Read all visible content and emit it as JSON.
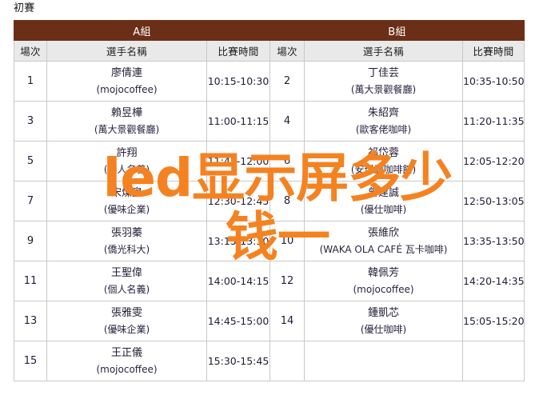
{
  "page": {
    "title": "初賽"
  },
  "watermark": {
    "line1": "led显示屏多少",
    "line2": "钱一",
    "color": "#F58220"
  },
  "table": {
    "colors": {
      "group_header_bg": "#6b2f18",
      "group_header_text": "#ffffff",
      "column_header_bg": "#e9e9e9",
      "border": "#c9c9c9",
      "cell_text": "#231c35"
    },
    "groups": [
      {
        "label": "A組"
      },
      {
        "label": "B組"
      }
    ],
    "columns": [
      "場次",
      "選手名稱",
      "比賽時間",
      "場次",
      "選手名稱",
      "比賽時間"
    ],
    "rows": [
      {
        "a_no": "1",
        "a_name": "廖倩連",
        "a_org": "(mojocoffee)",
        "a_time": "10:15-10:30",
        "b_no": "2",
        "b_name": "丁佳芸",
        "b_org": "(萬大景觀餐廳)",
        "b_time": "10:35-10:50"
      },
      {
        "a_no": "3",
        "a_name": "賴昱樺",
        "a_org": "(萬大景觀餐廳)",
        "a_time": "11:00-11:15",
        "b_no": "4",
        "b_name": "朱紹齊",
        "b_org": "(歐客佬咖啡)",
        "b_time": "11:20-11:35"
      },
      {
        "a_no": "5",
        "a_name": "許翔",
        "a_org": "(個人名義)",
        "a_time": "11:45-12:00",
        "b_no": "6",
        "b_name": "祁岱蓉",
        "b_org": "(安琪調咖啡館)",
        "b_time": "12:05-12:20"
      },
      {
        "a_no": "7",
        "a_name": "宋燦皇",
        "a_org": "(優味企業)",
        "a_time": "12:30-12:45",
        "b_no": "8",
        "b_name": "曾建誠",
        "b_org": "(優仕咖啡)",
        "b_time": "12:50-13:05"
      },
      {
        "a_no": "9",
        "a_name": "張羽蓁",
        "a_org": "(僑光科大)",
        "a_time": "13:15-13:30",
        "b_no": "10",
        "b_name": "張維欣",
        "b_org": "(WAKA OLA CAFÉ 瓦卡咖啡)",
        "b_time": "13:35-13:50"
      },
      {
        "a_no": "11",
        "a_name": "王聖偉",
        "a_org": "(個人名義)",
        "a_time": "14:00-14:15",
        "b_no": "12",
        "b_name": "韓佩芳",
        "b_org": "(mojocoffee)",
        "b_time": "14:20-14:35"
      },
      {
        "a_no": "13",
        "a_name": "張雅雯",
        "a_org": "(優味企業)",
        "a_time": "14:45-15:00",
        "b_no": "14",
        "b_name": "鍾凱芯",
        "b_org": "(優仕咖啡)",
        "b_time": "15:05-15:20"
      },
      {
        "a_no": "15",
        "a_name": "王正儀",
        "a_org": "(mojocoffee)",
        "a_time": "15:30-15:45",
        "b_no": "",
        "b_name": "",
        "b_org": "",
        "b_time": ""
      }
    ]
  }
}
